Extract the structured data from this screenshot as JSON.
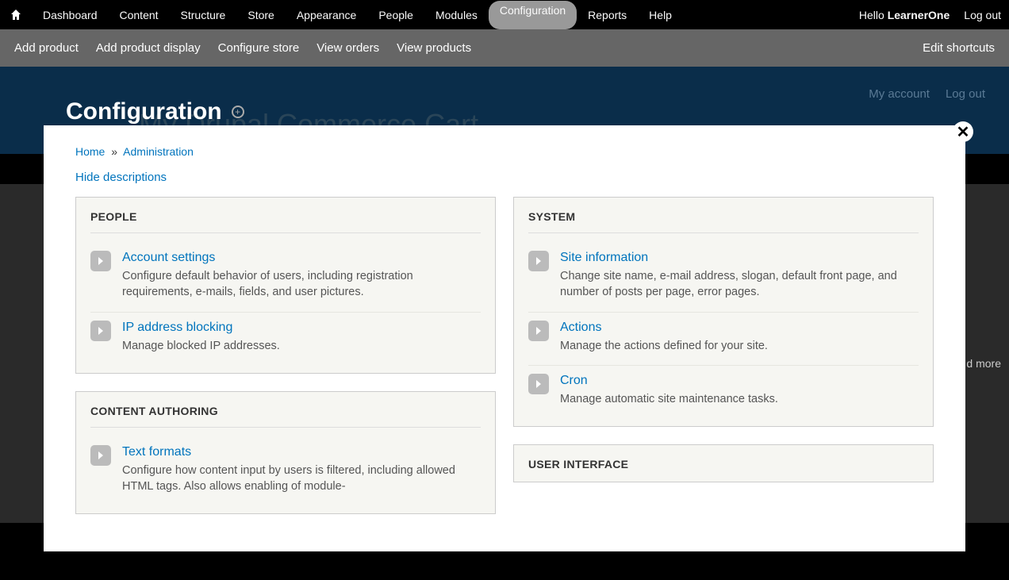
{
  "toolbar": {
    "menu": [
      "Dashboard",
      "Content",
      "Structure",
      "Store",
      "Appearance",
      "People",
      "Modules",
      "Configuration",
      "Reports",
      "Help"
    ],
    "active": "Configuration",
    "hello": "Hello ",
    "username": "LearnerOne",
    "logout": "Log out"
  },
  "shortcuts": {
    "items": [
      "Add product",
      "Add product display",
      "Configure store",
      "View orders",
      "View products"
    ],
    "edit": "Edit shortcuts"
  },
  "sitebg": {
    "title": "My Drupal Commerce Cart",
    "usermenu": [
      "My account",
      "Log out"
    ]
  },
  "overlay": {
    "title": "Configuration",
    "breadcrumb": {
      "home": "Home",
      "admin": "Administration"
    },
    "toggle": "Hide descriptions",
    "panels_left": [
      {
        "title": "PEOPLE",
        "items": [
          {
            "link": "Account settings",
            "desc": "Configure default behavior of users, including registration requirements, e-mails, fields, and user pictures."
          },
          {
            "link": "IP address blocking",
            "desc": "Manage blocked IP addresses."
          }
        ]
      },
      {
        "title": "CONTENT AUTHORING",
        "items": [
          {
            "link": "Text formats",
            "desc": "Configure how content input by users is filtered, including allowed HTML tags. Also allows enabling of module-"
          }
        ]
      }
    ],
    "panels_right": [
      {
        "title": "SYSTEM",
        "items": [
          {
            "link": "Site information",
            "desc": "Change site name, e-mail address, slogan, default front page, and number of posts per page, error pages."
          },
          {
            "link": "Actions",
            "desc": "Manage the actions defined for your site."
          },
          {
            "link": "Cron",
            "desc": "Manage automatic site maintenance tasks."
          }
        ]
      },
      {
        "title": "USER INTERFACE",
        "items": []
      }
    ]
  },
  "more": "d more"
}
